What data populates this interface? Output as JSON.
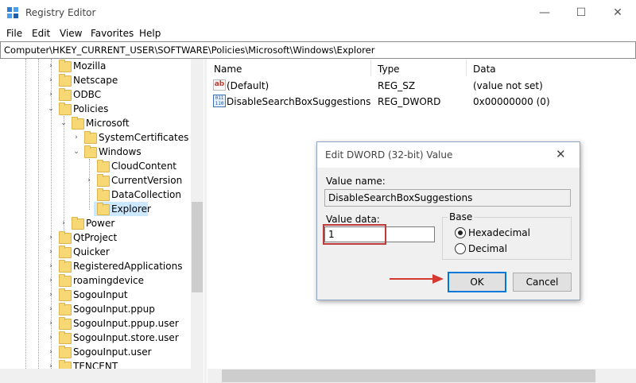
{
  "window": {
    "title": "Registry Editor",
    "minimize_glyph": "—",
    "maximize_glyph": "☐",
    "close_glyph": "✕"
  },
  "menu": {
    "items": [
      {
        "label": "File"
      },
      {
        "label": "Edit"
      },
      {
        "label": "View"
      },
      {
        "label": "Favorites"
      },
      {
        "label": "Help"
      }
    ]
  },
  "address": "Computer\\HKEY_CURRENT_USER\\SOFTWARE\\Policies\\Microsoft\\Windows\\Explorer",
  "tree": {
    "items": [
      {
        "label": "Mozilla"
      },
      {
        "label": "Netscape"
      },
      {
        "label": "ODBC"
      },
      {
        "label": "Policies"
      },
      {
        "label": "Microsoft"
      },
      {
        "label": "SystemCertificates"
      },
      {
        "label": "Windows"
      },
      {
        "label": "CloudContent"
      },
      {
        "label": "CurrentVersion"
      },
      {
        "label": "DataCollection"
      },
      {
        "label": "Explorer"
      },
      {
        "label": "Power"
      },
      {
        "label": "QtProject"
      },
      {
        "label": "Quicker"
      },
      {
        "label": "RegisteredApplications"
      },
      {
        "label": "roamingdevice"
      },
      {
        "label": "SogouInput"
      },
      {
        "label": "SogouInput.ppup"
      },
      {
        "label": "SogouInput.ppup.user"
      },
      {
        "label": "SogouInput.store.user"
      },
      {
        "label": "SogouInput.user"
      },
      {
        "label": "TENCENT"
      }
    ]
  },
  "values_table": {
    "columns": [
      "Name",
      "Type",
      "Data"
    ],
    "rows": [
      {
        "name": "(Default)",
        "type": "REG_SZ",
        "data": "(value not set)",
        "icon": "string-value-icon"
      },
      {
        "name": "DisableSearchBoxSuggestions",
        "type": "REG_DWORD",
        "data": "0x00000000 (0)",
        "icon": "binary-value-icon"
      }
    ]
  },
  "dialog": {
    "title": "Edit DWORD (32-bit) Value",
    "value_name_label": "Value name:",
    "value_name": "DisableSearchBoxSuggestions",
    "value_data_label": "Value data:",
    "value_data": "1",
    "base_label": "Base",
    "hex_label": "Hexadecimal",
    "dec_label": "Decimal",
    "selected_base": "Hexadecimal",
    "ok_label": "OK",
    "cancel_label": "Cancel",
    "highlight_color": "#c0393b",
    "arrow_color": "#d43a32"
  }
}
